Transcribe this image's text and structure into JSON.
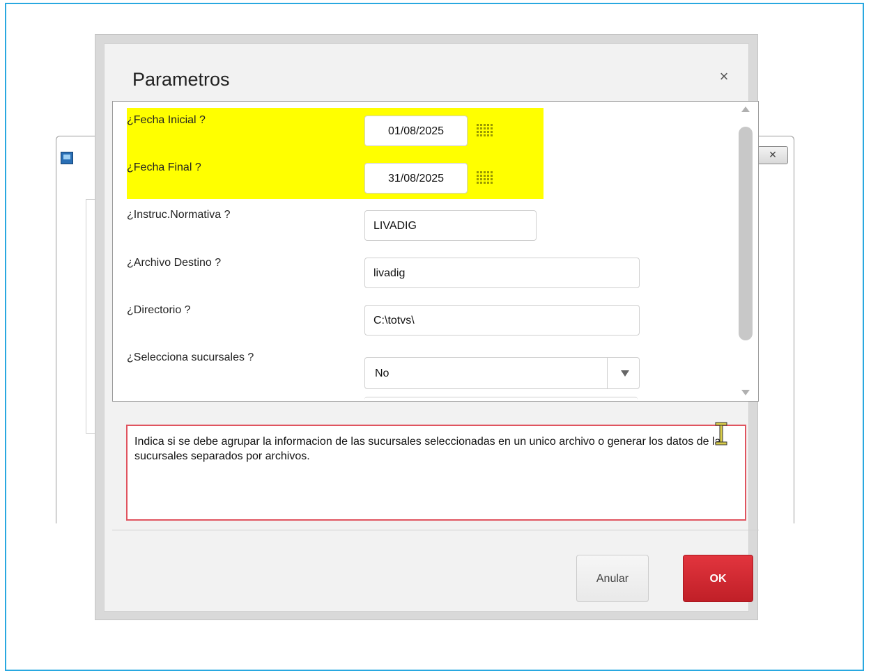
{
  "dialog": {
    "title": "Parametros",
    "close_symbol": "×",
    "close_icon": "close-icon"
  },
  "background_window": {
    "close_symbol": "✕",
    "app_icon": "app-window-icon"
  },
  "params": [
    {
      "label": "¿Fecha Inicial ?",
      "value": "01/08/2025",
      "type": "date",
      "highlighted": true
    },
    {
      "label": "¿Fecha Final ?",
      "value": "31/08/2025",
      "type": "date",
      "highlighted": true
    },
    {
      "label": "¿Instruc.Normativa ?",
      "value": "LIVADIG",
      "type": "text"
    },
    {
      "label": "¿Archivo Destino ?",
      "value": "livadig",
      "type": "text"
    },
    {
      "label": "¿Directorio ?",
      "value": "C:\\totvs\\",
      "type": "text"
    },
    {
      "label": "¿Selecciona sucursales ?",
      "value": "No",
      "type": "select"
    }
  ],
  "help_text": "Indica si se debe agrupar la informacion de las sucursales  seleccionadas en un unico archivo o generar los datos de la sucursales separados por archivos.",
  "buttons": {
    "cancel": "Anular",
    "ok": "OK"
  },
  "colors": {
    "highlight": "#ffff00",
    "ok_button": "#d42a33",
    "help_border": "#e0545f",
    "frame": "#29a8e0"
  }
}
